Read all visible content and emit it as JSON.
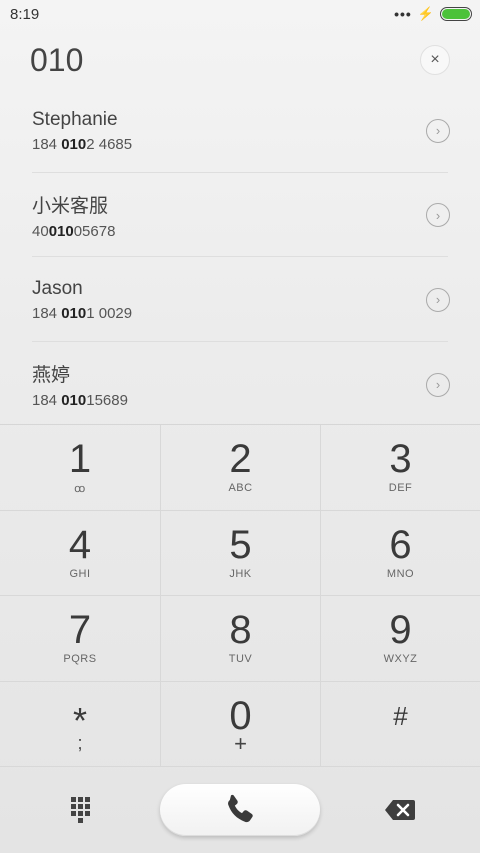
{
  "status_bar": {
    "time": "8:19",
    "overflow": "•••",
    "charging": "⚡",
    "battery_level": 1.0
  },
  "dialer": {
    "number": "010",
    "clear_label": "×"
  },
  "results": [
    {
      "name": "Stephanie",
      "pre": "184 ",
      "match": "010",
      "post": "2 4685"
    },
    {
      "name": "小米客服",
      "pre": "40",
      "match": "010",
      "post": "05678"
    },
    {
      "name": "Jason",
      "pre": "184 ",
      "match": "010",
      "post": "1 0029"
    },
    {
      "name": "燕婷",
      "pre": "184 ",
      "match": "010",
      "post": "15689"
    }
  ],
  "keypad": [
    {
      "digit": "1",
      "sub": "ꝏ"
    },
    {
      "digit": "2",
      "sub": "ABC"
    },
    {
      "digit": "3",
      "sub": "DEF"
    },
    {
      "digit": "4",
      "sub": "GHI"
    },
    {
      "digit": "5",
      "sub": "JHK"
    },
    {
      "digit": "6",
      "sub": "MNO"
    },
    {
      "digit": "7",
      "sub": "PQRS"
    },
    {
      "digit": "8",
      "sub": "TUV"
    },
    {
      "digit": "9",
      "sub": "WXYZ"
    },
    {
      "digit": "*",
      "sub": ";"
    },
    {
      "digit": "0",
      "sub": "+"
    },
    {
      "digit": "#",
      "sub": ""
    }
  ],
  "icons": {
    "keypad_toggle": "grid-icon",
    "call": "phone-icon",
    "backspace": "backspace-icon",
    "accent_green": "#4cc23a"
  }
}
